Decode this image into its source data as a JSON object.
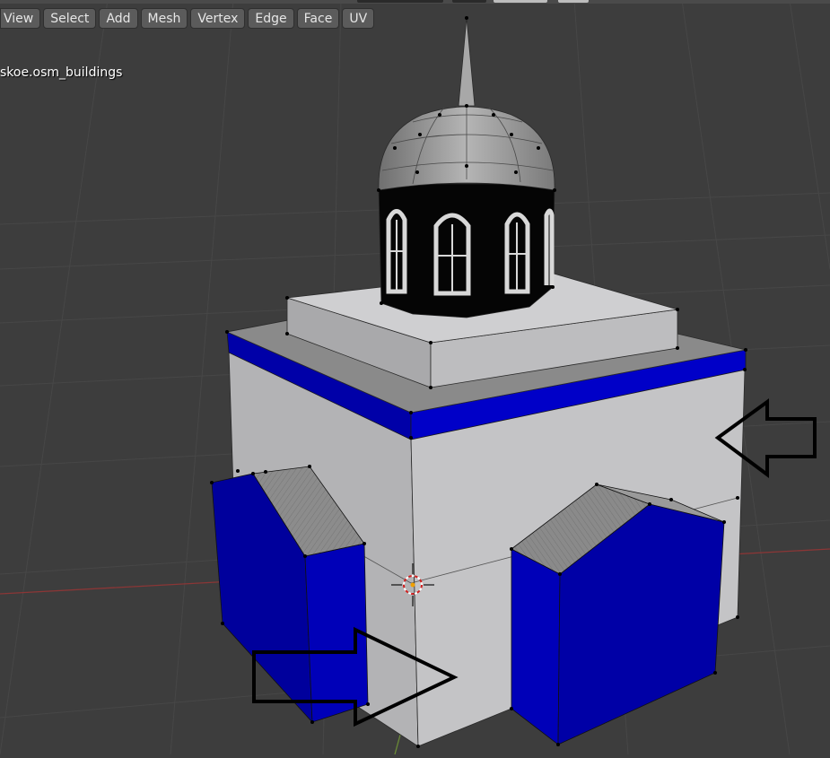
{
  "header": {
    "menus": [
      "View",
      "Select",
      "Add",
      "Mesh",
      "Vertex",
      "Edge",
      "Face",
      "UV"
    ]
  },
  "viewport": {
    "object_name": "skoe.osm_buildings",
    "background_color": "#3d3d3d",
    "grid_color": "#474747",
    "x_axis_color": "#8a3636",
    "y_axis_color": "#6a8a36",
    "wall_color": "#c4c4c6",
    "trim_color": "#0000b4",
    "roof_color": "#8c8c8c",
    "drum_color": "#050505",
    "annotation_arrows": [
      "arrow-left",
      "arrow-right"
    ]
  }
}
